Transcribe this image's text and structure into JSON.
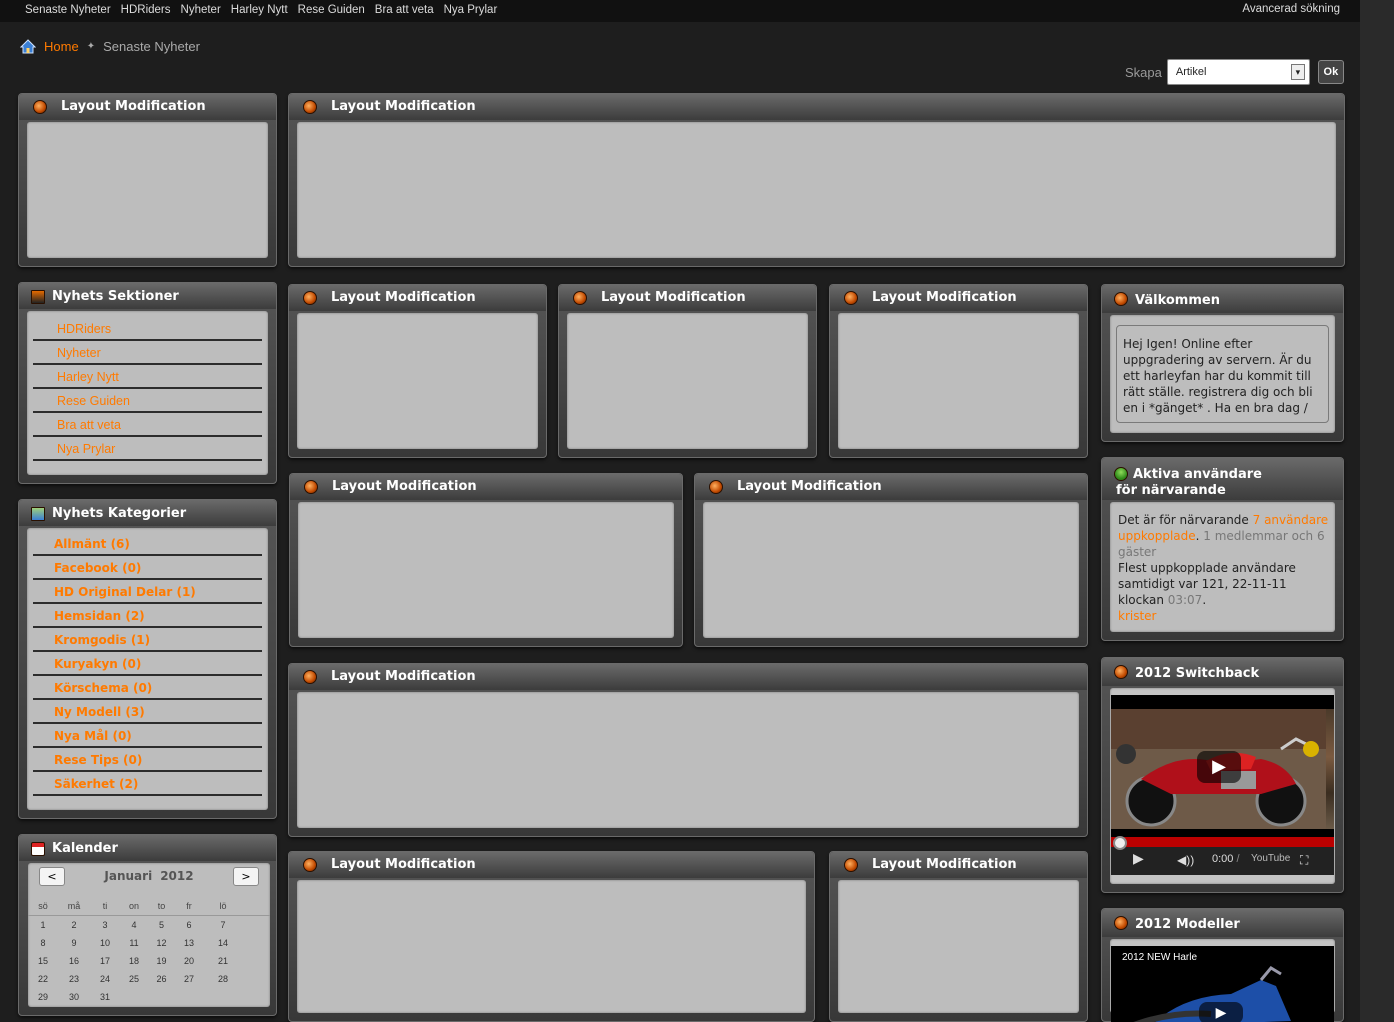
{
  "topnav": {
    "items": [
      "Senaste Nyheter",
      "HDRiders",
      "Nyheter",
      "Harley Nytt",
      "Rese Guiden",
      "Bra att veta",
      "Nya Prylar"
    ],
    "advanced_search": "Avancerad sökning"
  },
  "breadcrumb": {
    "home": "Home",
    "current": "Senaste Nyheter"
  },
  "create": {
    "label": "Skapa",
    "selected": "Artikel",
    "ok": "Ok"
  },
  "layout_title": "Layout Modification",
  "sections": {
    "title": "Nyhets Sektioner",
    "items": [
      "HDRiders",
      "Nyheter",
      "Harley Nytt",
      "Rese Guiden",
      "Bra att veta",
      "Nya Prylar"
    ]
  },
  "categories": {
    "title": "Nyhets Kategorier",
    "items": [
      "Allmänt (6)",
      "Facebook (0)",
      "HD Original Delar (1)",
      "Hemsidan (2)",
      "Kromgodis (1)",
      "Kuryakyn (0)",
      "Körschema (0)",
      "Ny Modell (3)",
      "Nya Mål (0)",
      "Rese Tips (0)",
      "Säkerhet (2)"
    ]
  },
  "calendar": {
    "title": "Kalender",
    "prev": "<",
    "next": ">",
    "month": "Januari",
    "year": "2012",
    "weekdays": [
      "sö",
      "må",
      "ti",
      "on",
      "to",
      "fr",
      "lö"
    ],
    "weeks": [
      [
        "1",
        "2",
        "3",
        "4",
        "5",
        "6",
        "7"
      ],
      [
        "8",
        "9",
        "10",
        "11",
        "12",
        "13",
        "14"
      ],
      [
        "15",
        "16",
        "17",
        "18",
        "19",
        "20",
        "21"
      ],
      [
        "22",
        "23",
        "24",
        "25",
        "26",
        "27",
        "28"
      ],
      [
        "29",
        "30",
        "31",
        "",
        "",
        "",
        ""
      ]
    ]
  },
  "welcome": {
    "title": "Välkommen",
    "text": "Hej Igen! Online efter uppgradering av servern. Är du ett harleyfan har du kommit till rätt ställe. registrera dig och bli en i *gänget* . Ha en bra dag /"
  },
  "online": {
    "title": "Aktiva användare för närvarande",
    "t1": "Det är för närvarande ",
    "t2": "7 användare uppkopplade",
    "t3": ". ",
    "t4": "1 medlemmar och 6 gäster",
    "t5": "Flest uppkopplade användare samtidigt var 121, 22-11-11 klockan ",
    "t6": "03:07",
    "t7": ".",
    "member": "krister"
  },
  "video1": {
    "title": "2012 Switchback",
    "time": "0:00",
    "sep": " / ",
    "brand": "YouTube"
  },
  "video2": {
    "title": "2012 Modeller",
    "caption": "2012 NEW Harle"
  },
  "colors": {
    "accent": "#ff7a00",
    "panel_body": "#bdbdbd",
    "background": "#1e1e1e"
  }
}
